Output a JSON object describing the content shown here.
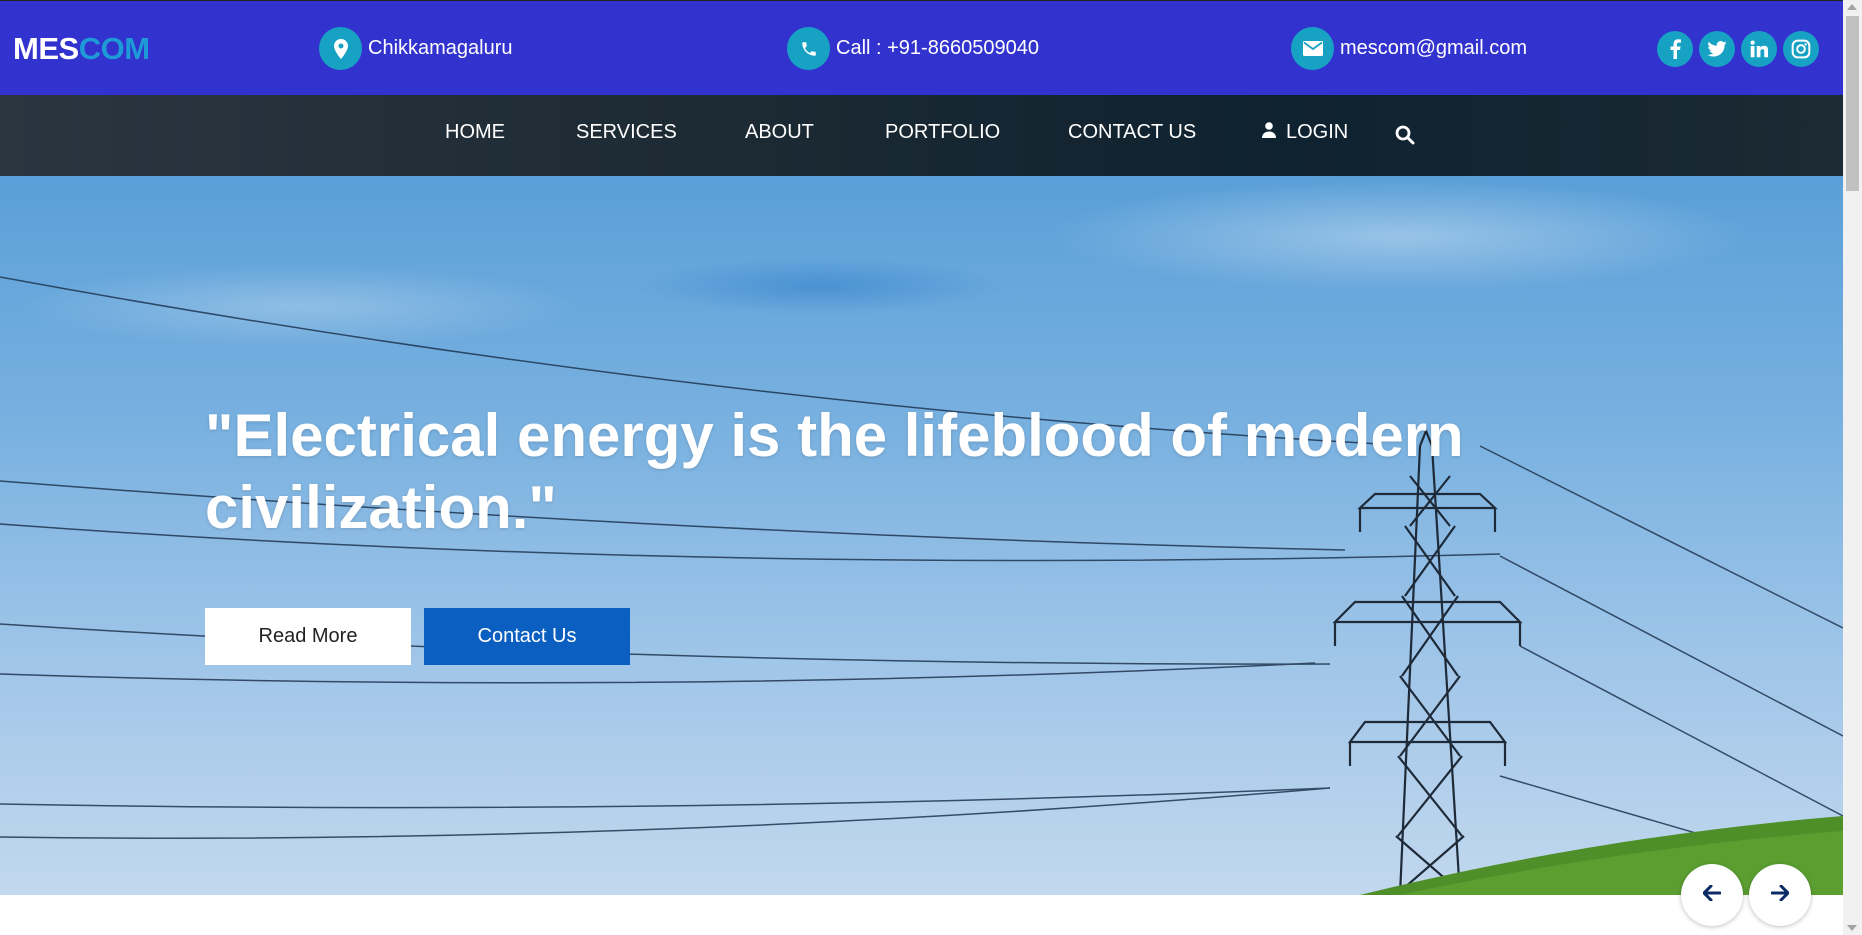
{
  "brand": {
    "part1": "MES",
    "part2": "COM"
  },
  "contact_bar": {
    "location": "Chikkamagaluru",
    "phone": "Call : +91-8660509040",
    "email": "mescom@gmail.com"
  },
  "social": [
    {
      "icon": "facebook-icon",
      "glyph": "f"
    },
    {
      "icon": "twitter-icon",
      "glyph": "t"
    },
    {
      "icon": "linkedin-icon",
      "glyph": "in"
    },
    {
      "icon": "instagram-icon",
      "glyph": "ig"
    }
  ],
  "nav": {
    "home": "HOME",
    "services": "SERVICES",
    "about": "ABOUT",
    "portfolio": "PORTFOLIO",
    "contact": "CONTACT US",
    "login": "LOGIN"
  },
  "hero": {
    "headline": "\"Electrical energy is the lifeblood of modern civilization.\"",
    "read_more": "Read More",
    "contact_us": "Contact Us"
  },
  "colors": {
    "topbar": "#3232cf",
    "icon_circle": "#17a2c4",
    "brand_accent": "#1e9bd7",
    "contact_button": "#0b5fc0"
  }
}
